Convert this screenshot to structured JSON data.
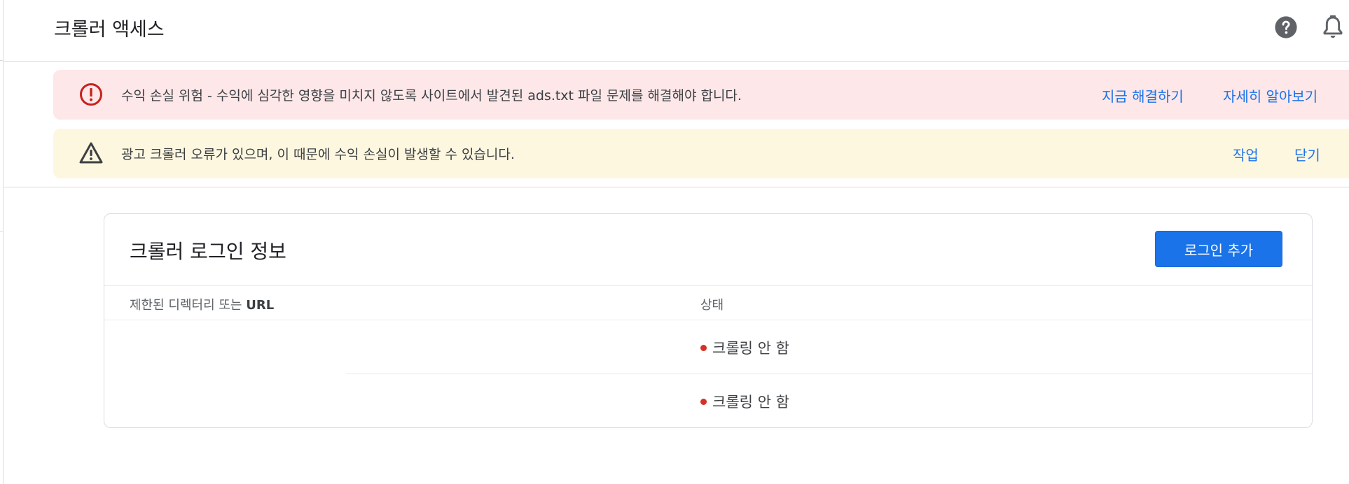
{
  "header": {
    "title": "크롤러 액세스",
    "icons": [
      "help-icon",
      "bell-icon"
    ]
  },
  "alerts": {
    "error": {
      "icon": "error-circle-icon",
      "text": "수익 손실 위험 - 수익에 심각한 영향을 미치지 않도록 사이트에서 발견된 ads.txt 파일 문제를 해결해야 합니다.",
      "action_fix": "지금 해결하기",
      "action_learn": "자세히 알아보기",
      "color": "#d93025"
    },
    "warning": {
      "icon": "warning-triangle-icon",
      "text": "광고 크롤러 오류가 있으며, 이 때문에 수익 손실이 발생할 수 있습니다.",
      "action_task": "작업",
      "action_close": "닫기"
    }
  },
  "card": {
    "title": "크롤러 로그인 정보",
    "add_login": "로그인 추가",
    "columns": {
      "directory_prefix": "제한된 디렉터리 또는 ",
      "directory_suffix": "URL",
      "status": "상태"
    },
    "rows": [
      {
        "directory": "",
        "status": "크롤링 안 함"
      },
      {
        "directory": "",
        "status": "크롤링 안 함"
      }
    ]
  },
  "colors": {
    "link": "#1a73e8",
    "primary_button": "#1a73e8",
    "status_dot": "#d93025",
    "error_bg": "#fde7e9",
    "warning_bg": "#fef7e0"
  }
}
